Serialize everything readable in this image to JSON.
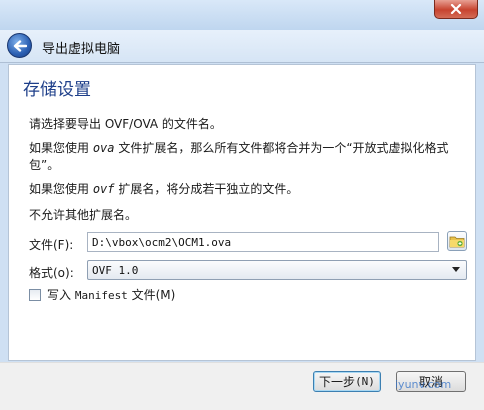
{
  "window": {
    "title": "导出虚拟电脑"
  },
  "page": {
    "title": "存储设置",
    "intro": "请选择要导出 OVF/OVA 的文件名。",
    "p2_before": "如果您使用 ",
    "p2_ext": "ova",
    "p2_after": " 文件扩展名，那么所有文件都将合并为一个“开放式虚拟化格式",
    "p2_line2": "包”。",
    "p3_before": "如果您使用 ",
    "p3_ext": "ovf",
    "p3_after": " 扩展名，将分成若干独立的文件。",
    "p4": "不允许其他扩展名。"
  },
  "file": {
    "label": "文件(F):",
    "value": "D:\\vbox\\ocm2\\OCM1.ova"
  },
  "format": {
    "label": "格式(o):",
    "selected": "OVF 1.0"
  },
  "manifest": {
    "label_prefix": "写入 ",
    "label_mono": "Manifest",
    "label_suffix": " 文件(M)",
    "checked": false
  },
  "buttons": {
    "next_prefix": "下一步",
    "next_shortcut": "(N)",
    "cancel": "取消"
  },
  "watermark": "iyunv.com",
  "colors": {
    "title_blue": "#1e3f8a",
    "close_red": "#c7432f",
    "back_blue": "#2b5fb2"
  }
}
